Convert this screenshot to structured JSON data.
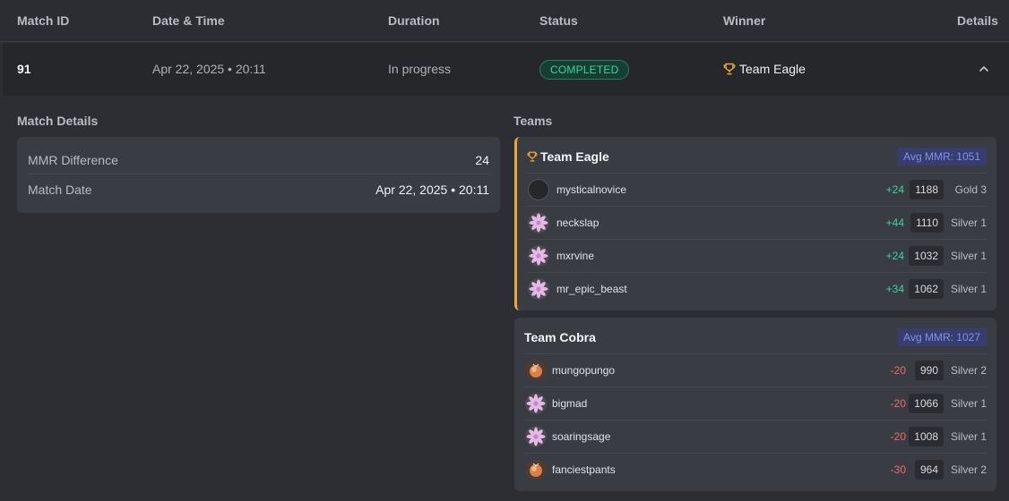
{
  "header": {
    "match_id": "Match ID",
    "date_time": "Date & Time",
    "duration": "Duration",
    "status": "Status",
    "winner": "Winner",
    "details": "Details"
  },
  "match": {
    "id": "91",
    "date_time": "Apr 22, 2025 • 20:11",
    "duration": "In progress",
    "status": "COMPLETED",
    "winner": "Team Eagle"
  },
  "match_details": {
    "title": "Match Details",
    "rows": [
      {
        "key": "MMR Difference",
        "value": "24"
      },
      {
        "key": "Match Date",
        "value": "Apr 22, 2025 • 20:11"
      }
    ]
  },
  "teams": {
    "title": "Teams",
    "list": [
      {
        "name": "Team Eagle",
        "avg_mmr": "Avg MMR: 1051",
        "winner": true,
        "players": [
          {
            "name": "mysticalnovice",
            "delta": "+24",
            "mmr": "1188",
            "rank": "Gold 3",
            "avatar": "blank-avatar"
          },
          {
            "name": "neckslap",
            "delta": "+44",
            "mmr": "1110",
            "rank": "Silver 1",
            "avatar": "flower-avatar"
          },
          {
            "name": "mxrvine",
            "delta": "+24",
            "mmr": "1032",
            "rank": "Silver 1",
            "avatar": "flower-avatar"
          },
          {
            "name": "mr_epic_beast",
            "delta": "+34",
            "mmr": "1062",
            "rank": "Silver 1",
            "avatar": "flower-avatar"
          }
        ]
      },
      {
        "name": "Team Cobra",
        "avg_mmr": "Avg MMR: 1027",
        "winner": false,
        "players": [
          {
            "name": "mungopungo",
            "delta": "-20",
            "mmr": "990",
            "rank": "Silver 2",
            "avatar": "orb-avatar"
          },
          {
            "name": "bigmad",
            "delta": "-20",
            "mmr": "1066",
            "rank": "Silver 1",
            "avatar": "flower-avatar"
          },
          {
            "name": "soaringsage",
            "delta": "-20",
            "mmr": "1008",
            "rank": "Silver 1",
            "avatar": "flower-avatar"
          },
          {
            "name": "fanciestpants",
            "delta": "-30",
            "mmr": "964",
            "rank": "Silver 2",
            "avatar": "orb-avatar"
          }
        ]
      }
    ]
  },
  "colors": {
    "status_green": "#3dd39b",
    "loss_red": "#ee6a6e",
    "winner_gold": "#e5a83a",
    "mmr_badge_blue": "#8191ea"
  },
  "icons": {
    "trophy": "trophy-icon",
    "collapse": "chevron-up-icon"
  }
}
